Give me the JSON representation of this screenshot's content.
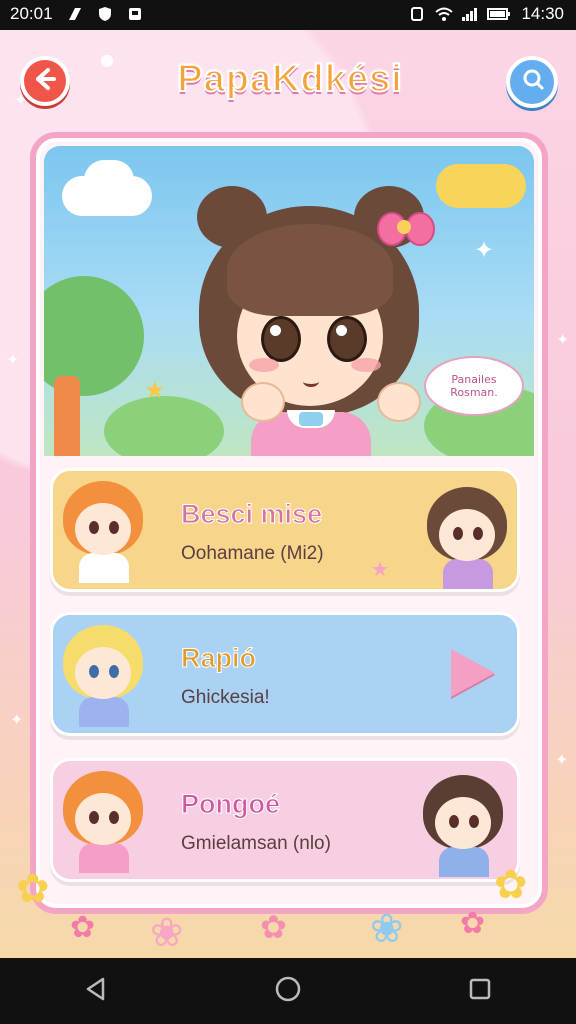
{
  "status_bar": {
    "time_left": "20:01",
    "time_right": "14:30",
    "left_icons": [
      "brand-icon",
      "shield-icon",
      "notification-icon"
    ],
    "right_icons": [
      "nfc-icon",
      "wifi-icon",
      "signal-icon",
      "battery-icon"
    ]
  },
  "header": {
    "title": "PapaKdkési",
    "back_icon": "back-arrow-icon",
    "profile_icon": "profile-icon"
  },
  "hero": {
    "speech_bubble": "Panailes Rosman."
  },
  "list": {
    "items": [
      {
        "title": "Besci mise",
        "subtitle": "Oohamane (Mi2)",
        "color": "#f7d58b",
        "title_color": "#d7739f"
      },
      {
        "title": "Rapió",
        "subtitle": "Ghickesia!",
        "color": "#a9d2f5",
        "title_color": "#e09b2b"
      },
      {
        "title": "Pongoé",
        "subtitle": "Gmielamsan (nlo)",
        "color": "#f8cfe2",
        "title_color": "#cf58a4"
      }
    ]
  },
  "nav": {
    "back": "nav-back-icon",
    "home": "nav-home-icon",
    "recents": "nav-recents-icon"
  },
  "colors": {
    "frame_border": "#f4a5c6",
    "back_button": "#f0554a",
    "profile_button": "#64aef0"
  }
}
